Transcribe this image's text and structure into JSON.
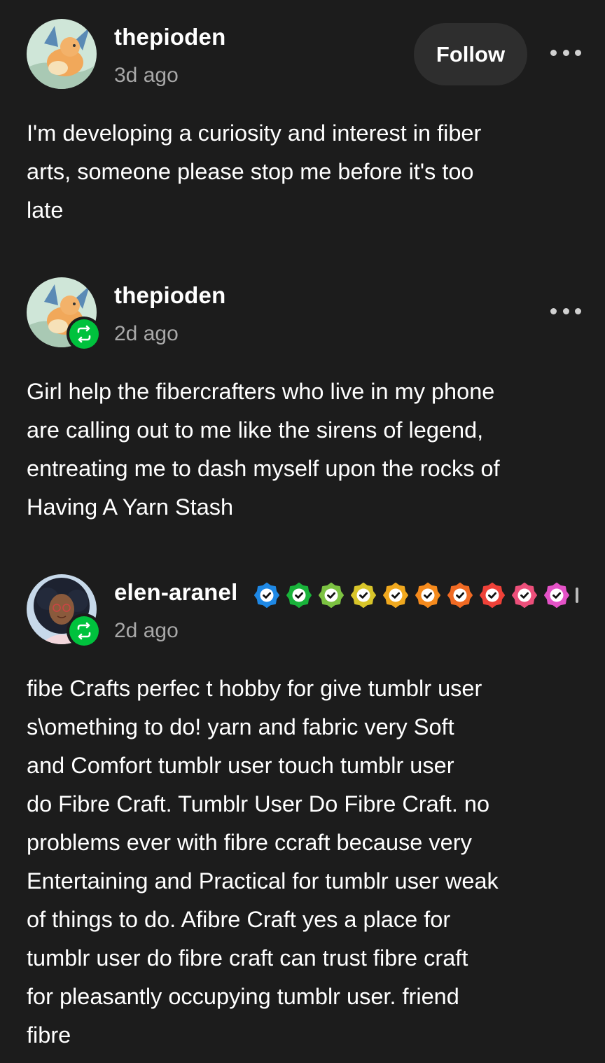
{
  "posts": [
    {
      "username": "thepioden",
      "time": "3d ago",
      "follow_label": "Follow",
      "reblog": false,
      "lines": [
        "I'm developing a curiosity and interest in fiber",
        "arts, someone please stop me before it's too",
        "late"
      ]
    },
    {
      "username": "thepioden",
      "time": "2d ago",
      "reblog": true,
      "lines": [
        "Girl help the fibercrafters who live in my phone",
        "are calling out to me like the sirens of legend,",
        "entreating me to dash myself upon the rocks of",
        "Having A Yarn Stash"
      ]
    },
    {
      "username": "elen-aranel",
      "time": "2d ago",
      "reblog": true,
      "badge_icon": "verified-check-badge-icon",
      "badge_colors": [
        "#1e88e5",
        "#19b33a",
        "#7cc242",
        "#d8c52a",
        "#f0a81e",
        "#f58a1c",
        "#f06a23",
        "#ee4138",
        "#ec4f7a",
        "#e452c7"
      ],
      "lines": [
        "fibe Crafts perfec t hobby for give tumblr user",
        "s\\omething to do! yarn and fabric very Soft",
        "and Comfort tumblr user touch tumblr user",
        "do Fibre Craft. Tumblr User Do Fibre Craft. no",
        "problems ever with fibre ccraft because very",
        "Entertaining and Practical for tumblr user weak",
        "of things to do. Afibre Craft yes a place for",
        "tumblr user do fibre craft can trust fibre craft",
        "for pleasantly occupying tumblr user. friend",
        "fibre"
      ]
    }
  ],
  "colors": {
    "background": "#1c1c1c",
    "reblog_green": "#00c23d",
    "follow_button": "#2e2e2e",
    "secondary_text": "#a8a8a8"
  }
}
